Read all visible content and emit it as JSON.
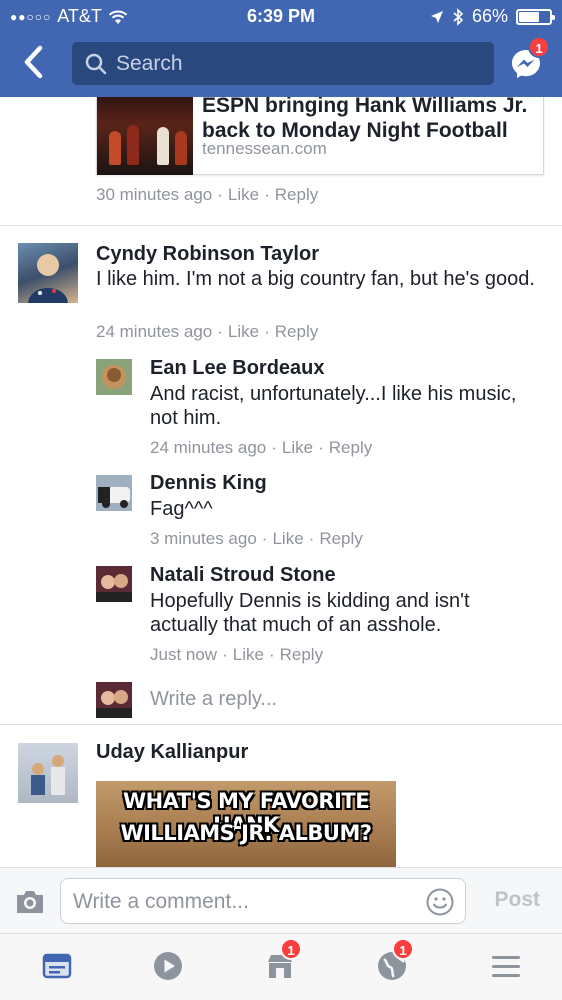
{
  "status_bar": {
    "signal": "●●○○○",
    "carrier": "AT&T",
    "time": "6:39 PM",
    "battery": "66%",
    "battery_level": 0.66
  },
  "nav": {
    "search_placeholder": "Search",
    "messenger_badge": "1"
  },
  "link_preview": {
    "title": "ESPN bringing Hank Williams Jr. back to Monday Night Football",
    "domain": "tennessean.com",
    "time": "30 minutes ago",
    "like_label": "Like",
    "reply_label": "Reply"
  },
  "comments": [
    {
      "name": "Cyndy Robinson Taylor",
      "text": "I like him.  I'm not a big country fan, but he's good.",
      "time": "24 minutes ago",
      "like_label": "Like",
      "reply_label": "Reply"
    },
    {
      "name": "Uday Kallianpur",
      "meme_line1": "WHAT'S MY FAVORITE HANK",
      "meme_line2": "WILLIAMS JR. ALBUM?"
    }
  ],
  "replies": [
    {
      "name": "Ean Lee Bordeaux",
      "text": "And racist, unfortunately...I like his music, not him.",
      "time": "24 minutes ago",
      "like_label": "Like",
      "reply_label": "Reply"
    },
    {
      "name": "Dennis King",
      "text": "Fag^^^",
      "time": "3 minutes ago",
      "like_label": "Like",
      "reply_label": "Reply"
    },
    {
      "name": "Natali Stroud Stone",
      "text": "Hopefully Dennis is kidding and isn't actually that much of an asshole.",
      "time": "Just now",
      "like_label": "Like",
      "reply_label": "Reply"
    }
  ],
  "write_reply_placeholder": "Write a reply...",
  "composer": {
    "placeholder": "Write a comment...",
    "post_label": "Post"
  },
  "tab_bar": {
    "tabs": [
      {
        "icon": "news-feed-icon",
        "badge": ""
      },
      {
        "icon": "video-icon",
        "badge": ""
      },
      {
        "icon": "marketplace-icon",
        "badge": "1"
      },
      {
        "icon": "notifications-globe-icon",
        "badge": "1"
      },
      {
        "icon": "menu-icon",
        "badge": ""
      }
    ]
  },
  "colors": {
    "brand_blue": "#4267b2",
    "search_bg": "#29487d",
    "badge_red": "#fa3e3e",
    "meta_gray": "#90949c"
  }
}
